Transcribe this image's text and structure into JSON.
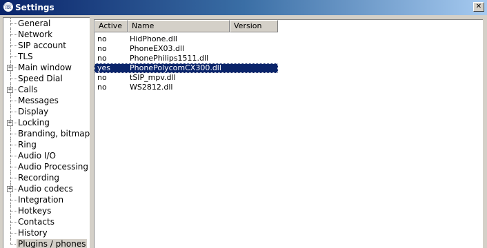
{
  "window": {
    "title": "Settings",
    "close_label": "✕"
  },
  "tree": {
    "items": [
      {
        "label": "General",
        "expandable": false
      },
      {
        "label": "Network",
        "expandable": false
      },
      {
        "label": "SIP account",
        "expandable": false
      },
      {
        "label": "TLS",
        "expandable": false
      },
      {
        "label": "Main window",
        "expandable": true
      },
      {
        "label": "Speed Dial",
        "expandable": false
      },
      {
        "label": "Calls",
        "expandable": true
      },
      {
        "label": "Messages",
        "expandable": false
      },
      {
        "label": "Display",
        "expandable": false
      },
      {
        "label": "Locking",
        "expandable": true
      },
      {
        "label": "Branding, bitmaps",
        "expandable": false
      },
      {
        "label": "Ring",
        "expandable": false
      },
      {
        "label": "Audio I/O",
        "expandable": false
      },
      {
        "label": "Audio Processing",
        "expandable": false
      },
      {
        "label": "Recording",
        "expandable": false
      },
      {
        "label": "Audio codecs",
        "expandable": true
      },
      {
        "label": "Integration",
        "expandable": false
      },
      {
        "label": "Hotkeys",
        "expandable": false
      },
      {
        "label": "Contacts",
        "expandable": false
      },
      {
        "label": "History",
        "expandable": false
      },
      {
        "label": "Plugins / phones",
        "expandable": false,
        "selected": true
      }
    ],
    "expand_glyph": "+"
  },
  "plugins": {
    "columns": [
      "Active",
      "Name",
      "Version"
    ],
    "rows": [
      {
        "active": "no",
        "name": "HidPhone.dll",
        "version": ""
      },
      {
        "active": "no",
        "name": "PhoneEX03.dll",
        "version": ""
      },
      {
        "active": "no",
        "name": "PhonePhilips1511.dll",
        "version": ""
      },
      {
        "active": "yes",
        "name": "PhonePolycomCX300.dll",
        "version": "",
        "selected": true
      },
      {
        "active": "no",
        "name": "tSIP_mpv.dll",
        "version": ""
      },
      {
        "active": "no",
        "name": "WS2812.dll",
        "version": ""
      }
    ]
  }
}
